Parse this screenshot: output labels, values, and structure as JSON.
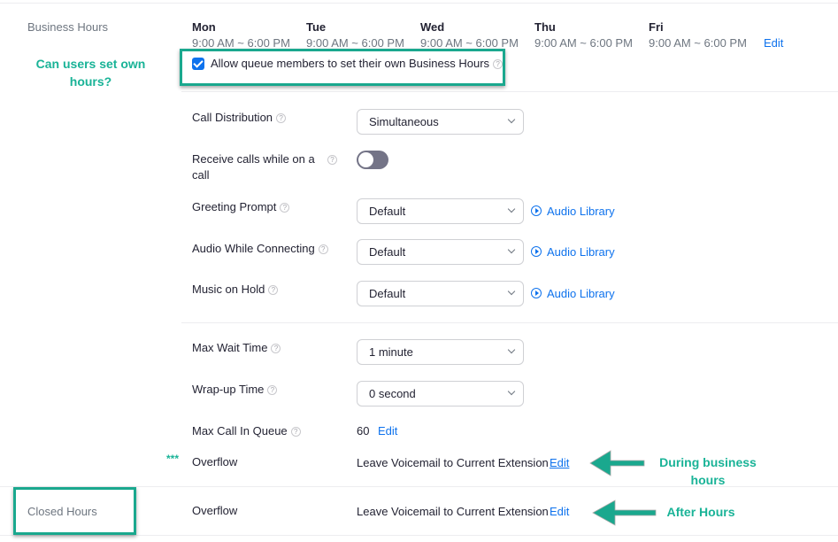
{
  "business_hours": {
    "section_label": "Business Hours",
    "days": [
      {
        "name": "Mon",
        "hours": "9:00 AM ~ 6:00 PM"
      },
      {
        "name": "Tue",
        "hours": "9:00 AM ~ 6:00 PM"
      },
      {
        "name": "Wed",
        "hours": "9:00 AM ~ 6:00 PM"
      },
      {
        "name": "Thu",
        "hours": "9:00 AM ~ 6:00 PM"
      },
      {
        "name": "Fri",
        "hours": "9:00 AM ~ 6:00 PM"
      }
    ],
    "edit_label": "Edit",
    "allow_members_label": "Allow queue members to set their own Business Hours",
    "allow_members_checked": true,
    "help_glyph": "?"
  },
  "settings": {
    "call_distribution": {
      "label": "Call Distribution",
      "value": "Simultaneous"
    },
    "receive_calls": {
      "label": "Receive calls while on a call",
      "enabled": false
    },
    "greeting_prompt": {
      "label": "Greeting Prompt",
      "value": "Default"
    },
    "audio_connecting": {
      "label": "Audio While Connecting",
      "value": "Default"
    },
    "music_on_hold": {
      "label": "Music on Hold",
      "value": "Default"
    },
    "audio_library_label": "Audio Library",
    "max_wait_time": {
      "label": "Max Wait Time",
      "value": "1 minute"
    },
    "wrap_up_time": {
      "label": "Wrap-up Time",
      "value": "0 second"
    },
    "max_call_in_queue": {
      "label": "Max Call In Queue",
      "value": "60",
      "edit_label": "Edit"
    },
    "overflow_business": {
      "label": "Overflow",
      "value": "Leave Voicemail to Current Extension",
      "edit_label": "Edit",
      "marker": "***"
    }
  },
  "closed_hours": {
    "section_label": "Closed Hours",
    "overflow": {
      "label": "Overflow",
      "value": "Leave Voicemail to Current Extension",
      "edit_label": "Edit"
    }
  },
  "annotations": {
    "can_users_set": "Can users set own hours?",
    "during_business": "During business hours",
    "after_hours": "After Hours",
    "accent_color": "#1aa88e"
  }
}
